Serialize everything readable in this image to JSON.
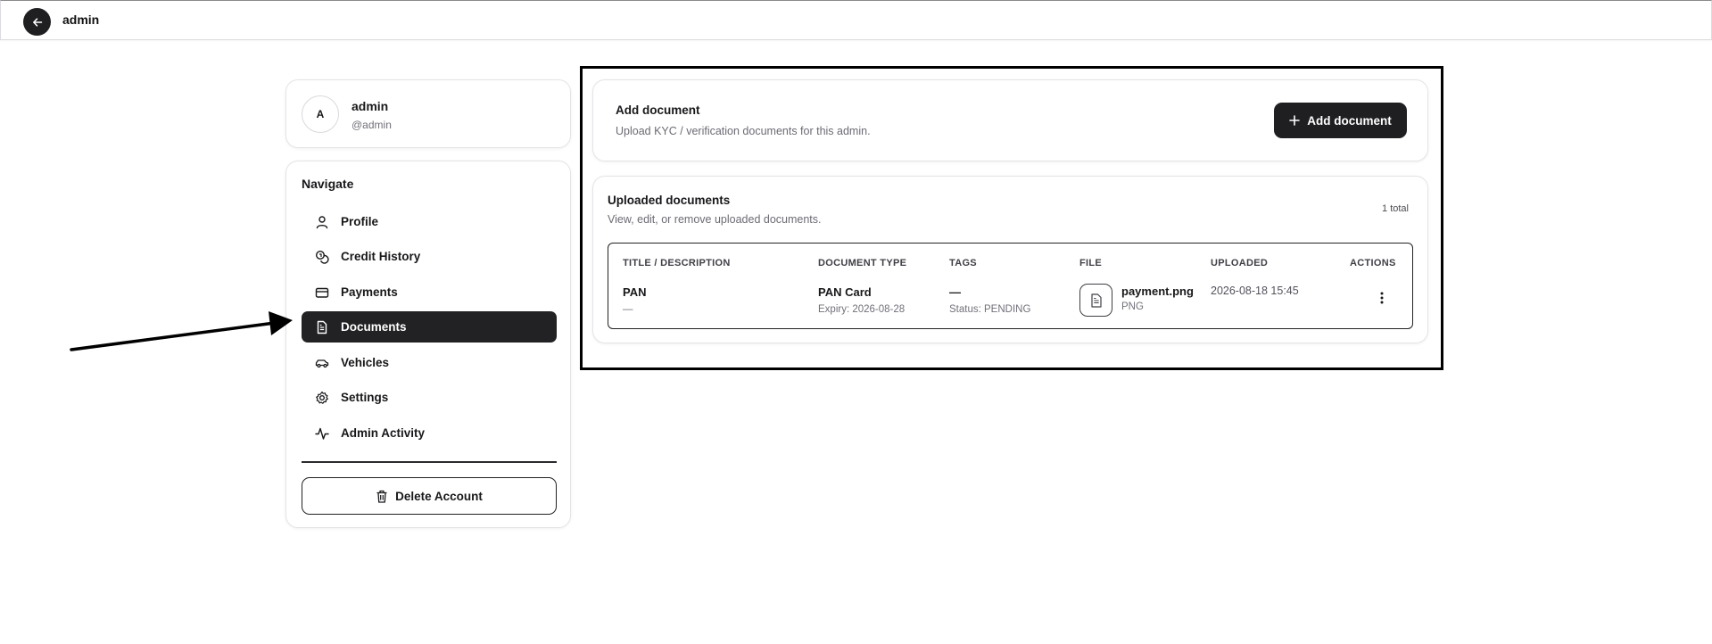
{
  "header": {
    "title": "admin",
    "back_icon": "arrow-left-icon"
  },
  "user": {
    "avatar_initial": "A",
    "name": "admin",
    "handle": "@admin"
  },
  "nav": {
    "heading": "Navigate",
    "items": [
      {
        "label": "Profile",
        "icon": "user-icon",
        "active": false
      },
      {
        "label": "Credit History",
        "icon": "coins-icon",
        "active": false
      },
      {
        "label": "Payments",
        "icon": "credit-card-icon",
        "active": false
      },
      {
        "label": "Documents",
        "icon": "document-icon",
        "active": true
      },
      {
        "label": "Vehicles",
        "icon": "car-icon",
        "active": false
      },
      {
        "label": "Settings",
        "icon": "gear-icon",
        "active": false
      },
      {
        "label": "Admin Activity",
        "icon": "activity-icon",
        "active": false
      }
    ],
    "delete_label": "Delete Account"
  },
  "add_document": {
    "title": "Add document",
    "subtitle": "Upload KYC / verification documents for this admin.",
    "button_label": "Add document"
  },
  "uploaded": {
    "title": "Uploaded documents",
    "subtitle": "View, edit, or remove uploaded documents.",
    "count_label": "1 total",
    "columns": [
      "TITLE / DESCRIPTION",
      "DOCUMENT TYPE",
      "TAGS",
      "FILE",
      "UPLOADED",
      "ACTIONS"
    ],
    "rows": [
      {
        "title": "PAN",
        "description": "—",
        "doc_type": "PAN Card",
        "expiry": "Expiry: 2026-08-28",
        "tags": "—",
        "status": "Status: PENDING",
        "file_name": "payment.png",
        "file_type": "PNG",
        "uploaded": "2026-08-18 15:45"
      }
    ]
  },
  "colors": {
    "primary_dark": "#1f1f22",
    "border": "#e4e4e7",
    "muted_text": "#6b6b74"
  }
}
